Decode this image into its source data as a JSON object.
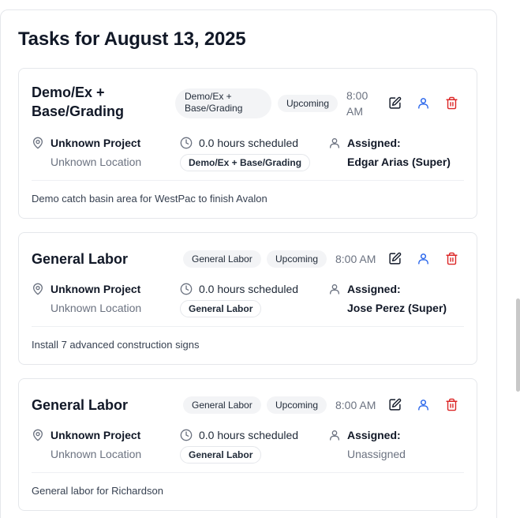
{
  "page": {
    "title": "Tasks for August 13, 2025"
  },
  "colors": {
    "edit_icon": "#111827",
    "assign_icon": "#2563eb",
    "delete_icon": "#dc2626",
    "chip_bg": "#f3f4f6"
  },
  "tasks": [
    {
      "title": "Demo/Ex + Base/Grading",
      "category": "Demo/Ex + Base/Grading",
      "status": "Upcoming",
      "time": "8:00 AM",
      "project": "Unknown Project",
      "location": "Unknown Location",
      "hours": "0.0 hours scheduled",
      "type": "Demo/Ex + Base/Grading",
      "assigned_label": "Assigned:",
      "assignee": "Edgar Arias (Super)",
      "description": "Demo catch basin area for WestPac to finish Avalon"
    },
    {
      "title": "General Labor",
      "category": "General Labor",
      "status": "Upcoming",
      "time": "8:00 AM",
      "project": "Unknown Project",
      "location": "Unknown Location",
      "hours": "0.0 hours scheduled",
      "type": "General Labor",
      "assigned_label": "Assigned:",
      "assignee": "Jose Perez (Super)",
      "description": "Install 7 advanced construction signs"
    },
    {
      "title": "General Labor",
      "category": "General Labor",
      "status": "Upcoming",
      "time": "8:00 AM",
      "project": "Unknown Project",
      "location": "Unknown Location",
      "hours": "0.0 hours scheduled",
      "type": "General Labor",
      "assigned_label": "Assigned:",
      "assignee": "Unassigned",
      "description": "General labor for Richardson"
    }
  ]
}
